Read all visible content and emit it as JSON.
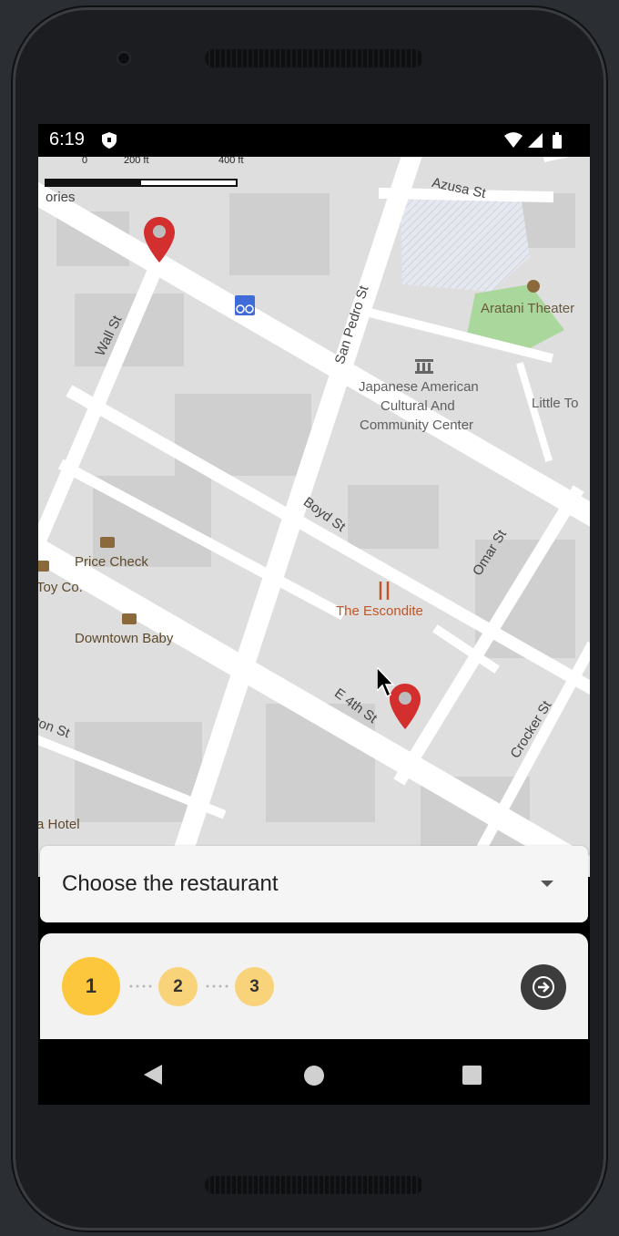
{
  "status_bar": {
    "time": "6:19"
  },
  "map": {
    "scale": {
      "zero": "0",
      "mid": "200 ft",
      "max": "400 ft"
    },
    "streets": {
      "azusa": "Azusa St",
      "wall": "Wall St",
      "san_pedro": "San Pedro St",
      "boyd": "Boyd St",
      "omar": "Omar St",
      "e4th": "E 4th St",
      "crocker": "Crocker St",
      "ton": "ton St"
    },
    "places": {
      "stories": "ories",
      "aratani": "Aratani Theater",
      "jaccc_line1": "Japanese American",
      "jaccc_line2": "Cultural And",
      "jaccc_line3": "Community Center",
      "little_tokyo": "Little To",
      "price_check": "Price Check",
      "toy_co": "Toy Co.",
      "escondite": "The Escondite",
      "downtown_baby": "Downtown Baby",
      "hotel": "a Hotel"
    }
  },
  "dropdown": {
    "label": "Choose the restaurant"
  },
  "stepper": {
    "steps": [
      "1",
      "2",
      "3"
    ]
  },
  "colors": {
    "accent_active": "#fcc73d",
    "accent_inactive": "#f9d37a",
    "marker": "#d32f2f",
    "restaurant": "#c0562a"
  }
}
